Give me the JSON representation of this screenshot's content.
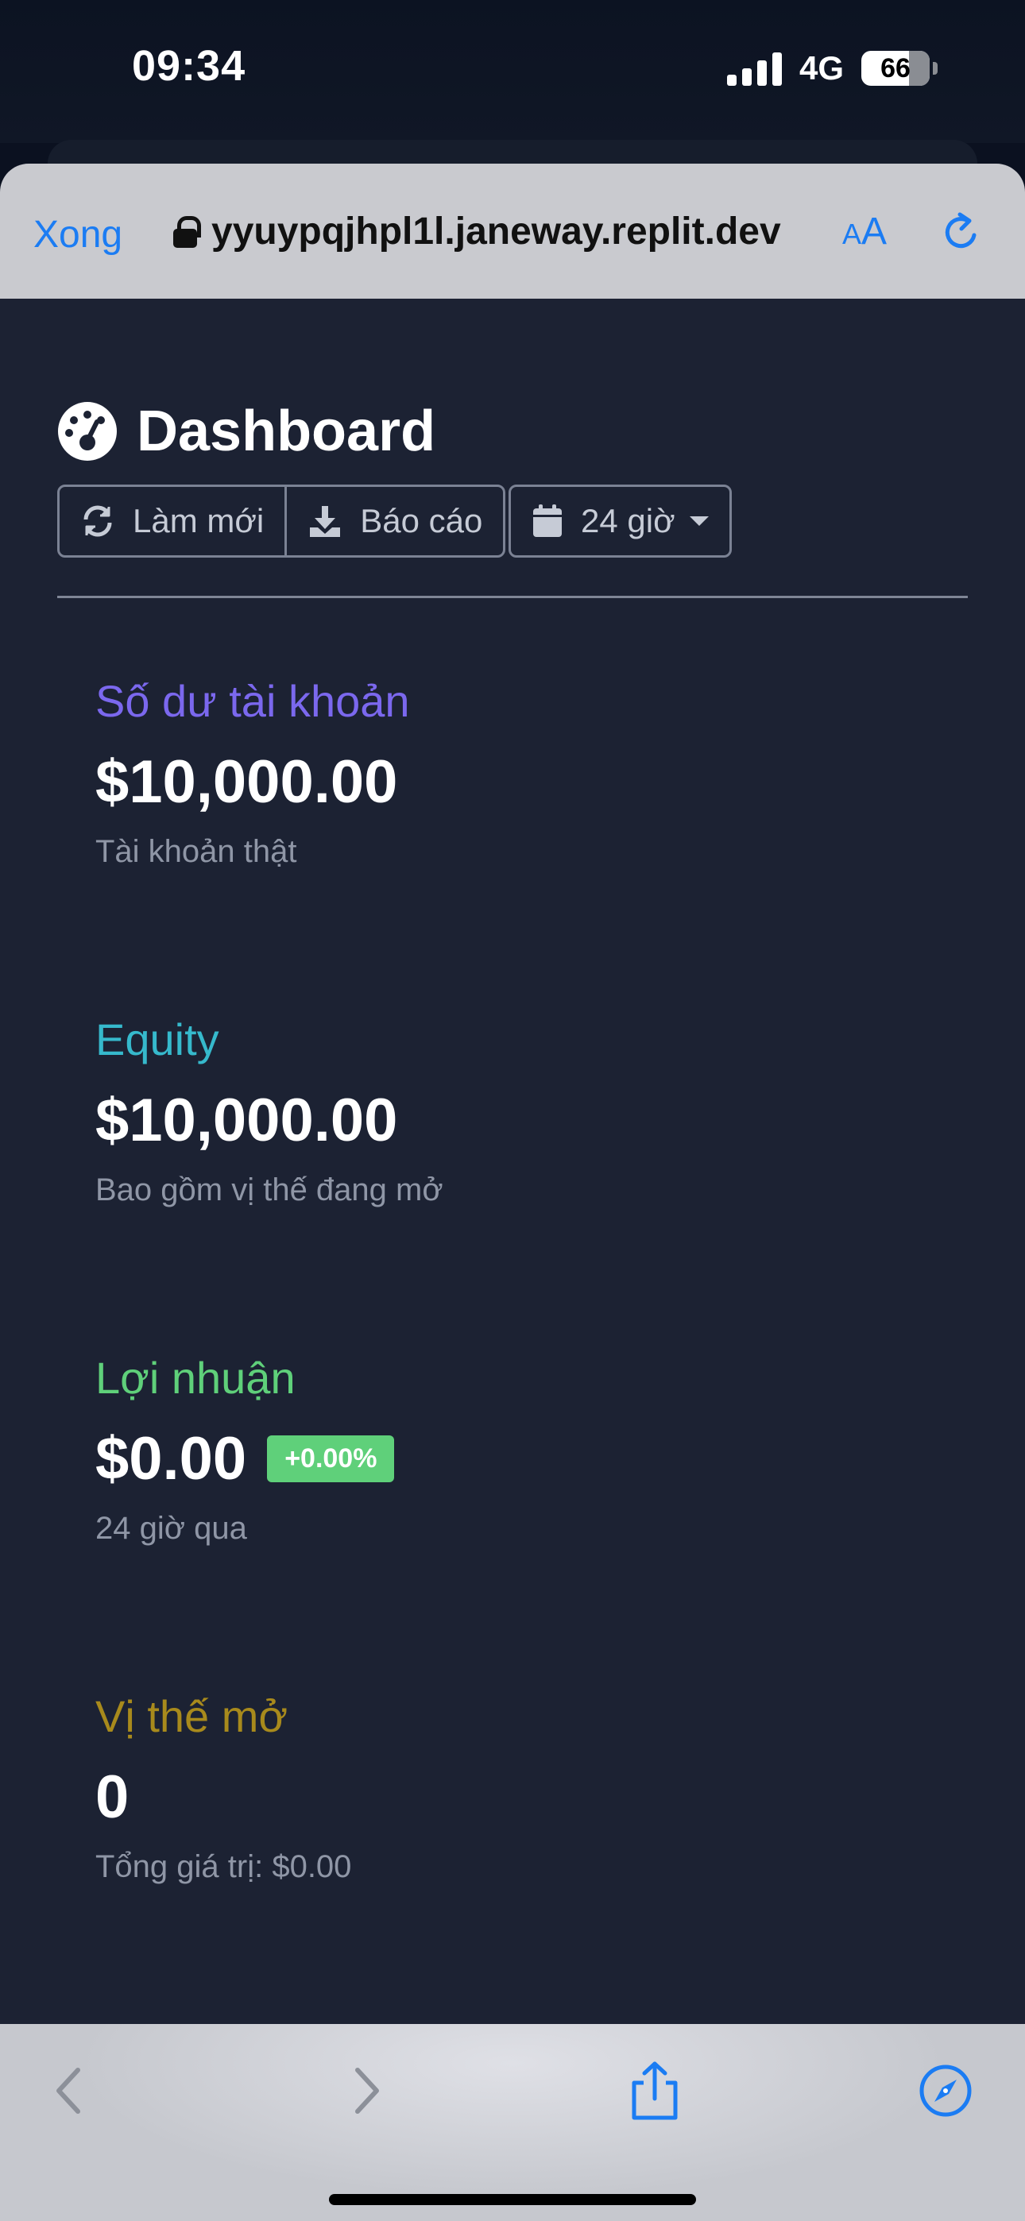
{
  "status_bar": {
    "time": "09:34",
    "network": "4G",
    "battery": "66"
  },
  "browser": {
    "done_label": "Xong",
    "url": "yyuypqjhpl1l.janeway.replit.dev",
    "text_size_label_small": "A",
    "text_size_label_large": "A"
  },
  "header": {
    "title": "Dashboard",
    "refresh_label": "Làm mới",
    "report_label": "Báo cáo",
    "range_label": "24 giờ"
  },
  "cards": [
    {
      "title": "Số dư tài khoản",
      "value": "$10,000.00",
      "subtitle": "Tài khoản thật",
      "color": "#7b68ee"
    },
    {
      "title": "Equity",
      "value": "$10,000.00",
      "subtitle": "Bao gồm vị thế đang mở",
      "color": "#36b9cc"
    },
    {
      "title": "Lợi nhuận",
      "value": "$0.00",
      "badge": "+0.00%",
      "subtitle": "24 giờ qua",
      "color": "#5fd07a"
    },
    {
      "title": "Vị thế mở",
      "value": "0",
      "subtitle": "Tổng giá trị: $0.00",
      "color": "#a88a1c"
    }
  ],
  "colors": {
    "accent": "#1b7cf3",
    "page_bg": "#1c2233",
    "badge_bg": "#5fd07a"
  },
  "icons": [
    "lock-icon",
    "reload-icon",
    "gauge-icon",
    "refresh-icon",
    "download-icon",
    "calendar-icon",
    "caret-down-icon",
    "back-icon",
    "forward-icon",
    "share-icon",
    "compass-icon"
  ]
}
